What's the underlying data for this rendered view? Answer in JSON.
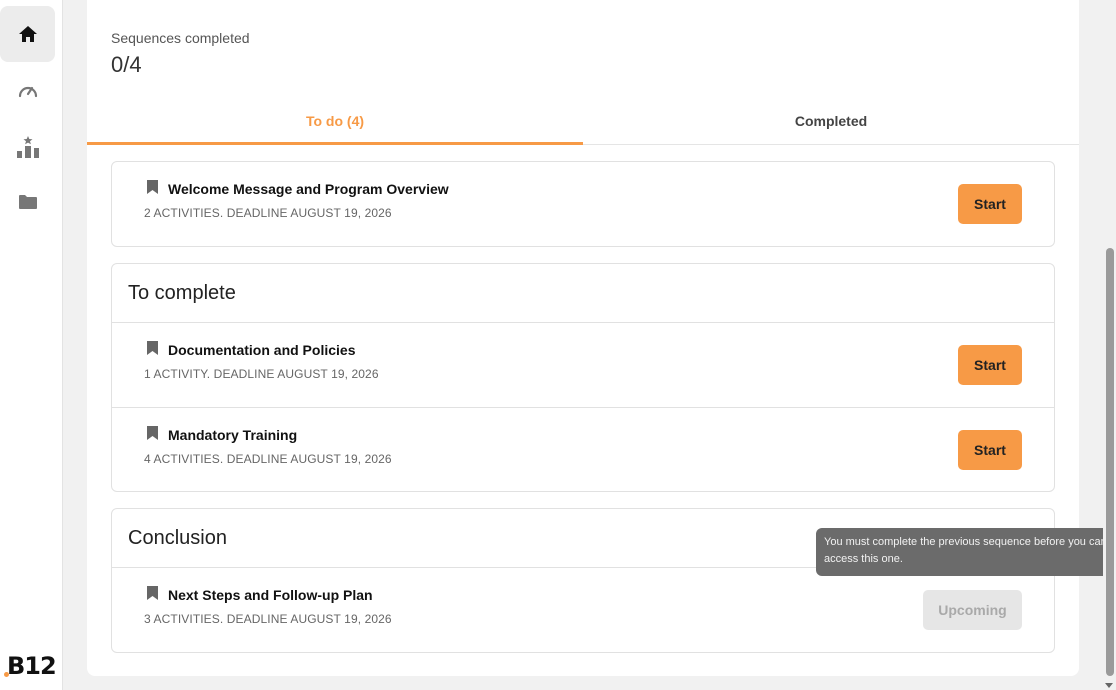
{
  "sidebar": {
    "items": [
      {
        "name": "home",
        "icon": "home-icon",
        "active": true
      },
      {
        "name": "dashboard",
        "icon": "speedometer-icon",
        "active": false
      },
      {
        "name": "leaderboard",
        "icon": "podium-icon",
        "active": false
      },
      {
        "name": "files",
        "icon": "folder-icon",
        "active": false
      }
    ],
    "logo_text": "B12"
  },
  "stats": {
    "label": "Sequences completed",
    "value": "0/4"
  },
  "tabs": {
    "todo": "To do (4)",
    "completed": "Completed"
  },
  "sequences": {
    "standalone": {
      "title": "Welcome Message and Program Overview",
      "meta": "2 ACTIVITIES. DEADLINE AUGUST 19, 2026",
      "button": "Start"
    },
    "to_complete": {
      "heading": "To complete",
      "items": [
        {
          "title": "Documentation and Policies",
          "meta": "1 ACTIVITY. DEADLINE AUGUST 19, 2026",
          "button": "Start"
        },
        {
          "title": "Mandatory Training",
          "meta": "4 ACTIVITIES. DEADLINE AUGUST 19, 2026",
          "button": "Start"
        }
      ]
    },
    "conclusion": {
      "heading": "Conclusion",
      "items": [
        {
          "title": "Next Steps and Follow-up Plan",
          "meta": "3 ACTIVITIES. DEADLINE AUGUST 19, 2026",
          "button": "Upcoming"
        }
      ]
    }
  },
  "tooltip": "You must complete the previous sequence before you can access this one.",
  "colors": {
    "accent": "#f79a46",
    "tooltip_bg": "#6b6b6b"
  }
}
